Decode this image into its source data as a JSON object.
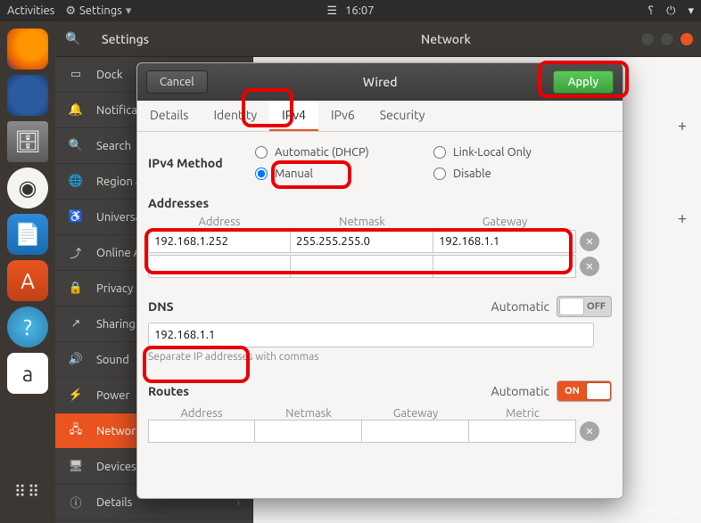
{
  "top_panel": {
    "activities": "Activities",
    "settings_menu": "Settings",
    "time": "16:07",
    "status_icons": [
      "help",
      "power",
      "dropdown"
    ]
  },
  "settings_window": {
    "search_icon": "🔍",
    "title_left": "Settings",
    "title_right": "Network"
  },
  "sidebar": {
    "items": [
      {
        "icon": "▭",
        "label": "Dock"
      },
      {
        "icon": "🔔",
        "label": "Notifications"
      },
      {
        "icon": "🔍",
        "label": "Search"
      },
      {
        "icon": "🌐",
        "label": "Region & Language"
      },
      {
        "icon": "♿",
        "label": "Universal Access"
      },
      {
        "icon": "⤴",
        "label": "Online Accounts"
      },
      {
        "icon": "🔒",
        "label": "Privacy"
      },
      {
        "icon": "↗",
        "label": "Sharing"
      },
      {
        "icon": "🔊",
        "label": "Sound"
      },
      {
        "icon": "⚡",
        "label": "Power"
      },
      {
        "icon": "🖧",
        "label": "Network",
        "active": true
      },
      {
        "icon": "🖥",
        "label": "Devices",
        "chev": true
      },
      {
        "icon": "ⓘ",
        "label": "Details",
        "chev": true
      }
    ]
  },
  "dialog": {
    "cancel": "Cancel",
    "title": "Wired",
    "apply": "Apply",
    "tabs": [
      "Details",
      "Identity",
      "IPv4",
      "IPv6",
      "Security"
    ],
    "active_tab": 2,
    "ipv4": {
      "method_label": "IPv4 Method",
      "options": {
        "auto": "Automatic (DHCP)",
        "linklocal": "Link-Local Only",
        "manual": "Manual",
        "disable": "Disable"
      },
      "selected": "manual",
      "addresses": {
        "title": "Addresses",
        "headers": [
          "Address",
          "Netmask",
          "Gateway"
        ],
        "rows": [
          {
            "address": "192.168.1.252",
            "netmask": "255.255.255.0",
            "gateway": "192.168.1.1"
          },
          {
            "address": "",
            "netmask": "",
            "gateway": ""
          }
        ]
      },
      "dns": {
        "title": "DNS",
        "automatic_label": "Automatic",
        "toggle_off": "OFF",
        "value": "192.168.1.1",
        "hint": "Separate IP addresses with commas"
      },
      "routes": {
        "title": "Routes",
        "automatic_label": "Automatic",
        "toggle_on": "ON",
        "headers": [
          "Address",
          "Netmask",
          "Gateway",
          "Metric"
        ]
      }
    }
  },
  "watermark": "亿速云"
}
